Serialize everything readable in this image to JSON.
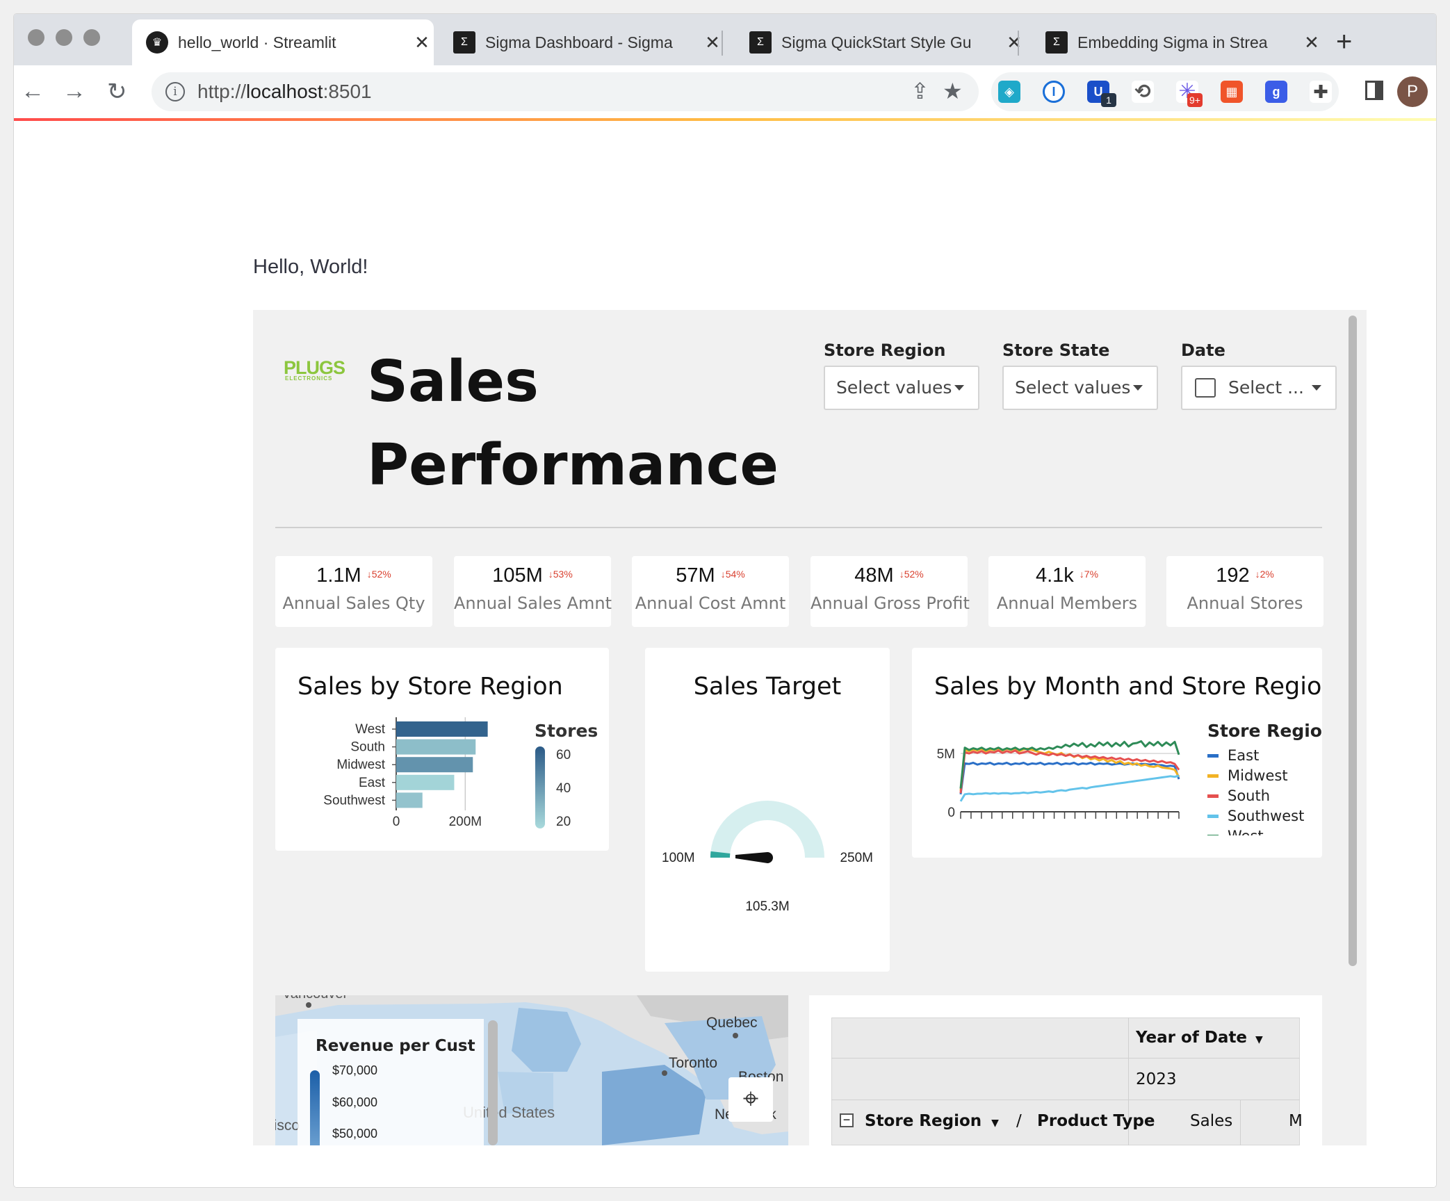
{
  "browser": {
    "tabs": [
      {
        "title": "hello_world · Streamlit",
        "favicon": "streamlit-crown-icon"
      },
      {
        "title": "Sigma Dashboard - Sigma",
        "favicon": "sigma-icon"
      },
      {
        "title": "Sigma QuickStart Style Gu",
        "favicon": "sigma-icon"
      },
      {
        "title": "Embedding Sigma in Strea",
        "favicon": "sigma-icon"
      }
    ],
    "url_prefix": "http://",
    "url_host": "localhost",
    "url_port": ":8501",
    "extension_badges": [
      "1",
      "9+"
    ],
    "profile_initial": "P"
  },
  "page": {
    "greeting": "Hello, World!"
  },
  "dashboard": {
    "logo": "PLUGS",
    "logo_sub": "ELECTRONICS",
    "title": "Sales Performance",
    "filters": [
      {
        "label": "Store Region",
        "value": "Select values"
      },
      {
        "label": "Store State",
        "value": "Select values"
      },
      {
        "label": "Date",
        "value": "Select ..."
      }
    ],
    "kpis": [
      {
        "value": "1.1M",
        "change": "52%",
        "label": "Annual Sales Qty"
      },
      {
        "value": "105M",
        "change": "53%",
        "label": "Annual Sales Amnt"
      },
      {
        "value": "57M",
        "change": "54%",
        "label": "Annual Cost Amnt"
      },
      {
        "value": "48M",
        "change": "52%",
        "label": "Annual Gross Profit"
      },
      {
        "value": "4.1k",
        "change": "7%",
        "label": "Annual Members"
      },
      {
        "value": "192",
        "change": "2%",
        "label": "Annual Stores"
      }
    ],
    "map": {
      "legend_title": "Revenue per Cust",
      "legend_ticks": [
        "$70,000",
        "$60,000",
        "$50,000"
      ],
      "places": [
        "Vancouver",
        "Quebec",
        "Toronto",
        "Boston",
        "United States",
        "New York",
        "Francisco"
      ]
    },
    "pivot": {
      "col_header": "Year of Date",
      "year": "2023",
      "row_header_1": "Store Region",
      "separator": "/",
      "row_header_2": "Product Type",
      "measure_1": "Sales",
      "measure_2": "M"
    }
  },
  "chart_data": [
    {
      "type": "bar",
      "title": "Sales by Store Region",
      "orientation": "horizontal",
      "categories": [
        "West",
        "South",
        "Midwest",
        "East",
        "Southwest"
      ],
      "values": [
        265,
        230,
        222,
        168,
        76
      ],
      "value_unit": "M",
      "xlim": [
        0,
        280
      ],
      "x_ticks": [
        "0",
        "200M"
      ],
      "legend_title": "Stores",
      "color_by": "stores",
      "color_values": [
        62,
        30,
        45,
        22,
        28
      ],
      "color_ticks": [
        "60",
        "40",
        "20"
      ],
      "color_light": "#a9dadc",
      "color_dark": "#2b5a87"
    },
    {
      "type": "gauge",
      "title": "Sales Target",
      "min": 100,
      "max": 250,
      "value": 105.3,
      "min_label": "100M",
      "max_label": "250M",
      "value_label": "105.3M",
      "track_color": "#d6efef",
      "fill_color": "#2fa79d"
    },
    {
      "type": "line",
      "title": "Sales by Month and Store Region",
      "legend_title": "Store Region",
      "y_ticks": [
        "5M",
        "0"
      ],
      "ylim": [
        0,
        6.2
      ],
      "x": [
        1,
        2,
        3,
        4,
        5,
        6,
        7,
        8,
        9,
        10,
        11,
        12,
        13,
        14,
        15,
        16,
        17,
        18,
        19,
        20,
        21,
        22,
        23,
        24,
        25,
        26,
        27,
        28,
        29,
        30,
        31,
        32,
        33,
        34,
        35,
        36,
        37,
        38,
        39,
        40,
        41,
        42,
        43,
        44,
        45,
        46,
        47,
        48,
        49,
        50,
        51,
        52,
        53
      ],
      "series": [
        {
          "name": "East",
          "color": "#2a6fc7",
          "values": [
            1.5,
            4.15,
            4.1,
            4.2,
            4.05,
            4.15,
            4.1,
            4.2,
            4.05,
            4.15,
            4.1,
            4.2,
            4.05,
            4.15,
            4.1,
            4.2,
            4.05,
            4.15,
            4.1,
            4.2,
            4.05,
            4.15,
            4.1,
            4.2,
            4.05,
            4.15,
            4.1,
            4.2,
            4.05,
            4.15,
            4.1,
            4.2,
            4.05,
            4.15,
            4.1,
            4.15,
            4.05,
            4.1,
            4.15,
            4.05,
            4.1,
            4.15,
            4.05,
            4.1,
            4.1,
            4.05,
            4.1,
            4.0,
            4.0,
            3.9,
            3.95,
            3.9,
            2.8
          ]
        },
        {
          "name": "Midwest",
          "color": "#f2b325",
          "values": [
            1.8,
            5.3,
            5.2,
            5.35,
            5.25,
            5.4,
            5.2,
            5.35,
            5.3,
            5.45,
            5.25,
            5.4,
            5.3,
            5.45,
            5.2,
            5.35,
            5.4,
            5.3,
            5.2,
            5.1,
            5.0,
            5.15,
            5.0,
            4.9,
            5.05,
            4.8,
            4.95,
            4.7,
            4.85,
            4.6,
            4.75,
            4.5,
            4.6,
            4.4,
            4.55,
            4.3,
            4.45,
            4.2,
            4.35,
            4.1,
            4.2,
            4.05,
            4.15,
            3.95,
            4.05,
            3.9,
            3.85,
            3.95,
            3.8,
            3.75,
            3.7,
            3.6,
            3.0
          ]
        },
        {
          "name": "South",
          "color": "#e5504f",
          "values": [
            1.6,
            5.1,
            5.0,
            5.15,
            5.05,
            5.2,
            5.0,
            5.15,
            5.1,
            5.25,
            5.05,
            5.2,
            5.1,
            5.25,
            5.0,
            5.1,
            5.2,
            5.05,
            4.9,
            5.05,
            4.95,
            4.85,
            5.0,
            4.85,
            4.95,
            4.8,
            4.9,
            4.75,
            4.85,
            4.7,
            4.8,
            4.65,
            4.75,
            4.6,
            4.7,
            4.55,
            4.65,
            4.5,
            4.6,
            4.45,
            4.55,
            4.4,
            4.5,
            4.35,
            4.45,
            4.3,
            4.4,
            4.25,
            4.35,
            4.2,
            4.25,
            4.1,
            3.6
          ]
        },
        {
          "name": "Southwest",
          "color": "#63c3ea",
          "values": [
            0.9,
            1.5,
            1.55,
            1.5,
            1.55,
            1.55,
            1.6,
            1.55,
            1.6,
            1.55,
            1.6,
            1.6,
            1.55,
            1.6,
            1.6,
            1.65,
            1.6,
            1.65,
            1.7,
            1.65,
            1.7,
            1.75,
            1.7,
            1.8,
            1.85,
            1.8,
            1.9,
            1.95,
            2.0,
            2.05,
            2.0,
            2.1,
            2.15,
            2.2,
            2.25,
            2.3,
            2.35,
            2.4,
            2.45,
            2.5,
            2.55,
            2.6,
            2.65,
            2.7,
            2.75,
            2.8,
            2.85,
            2.9,
            2.95,
            3.0,
            3.05,
            3.0,
            3.1
          ]
        },
        {
          "name": "West",
          "color": "#2e8b57",
          "values": [
            2.0,
            5.5,
            5.3,
            5.45,
            5.35,
            5.5,
            5.3,
            5.45,
            5.35,
            5.5,
            5.3,
            5.45,
            5.35,
            5.5,
            5.3,
            5.45,
            5.35,
            5.5,
            5.3,
            5.45,
            5.35,
            5.5,
            5.4,
            5.6,
            5.5,
            5.75,
            5.6,
            5.85,
            5.65,
            5.9,
            5.55,
            5.8,
            5.6,
            5.95,
            5.7,
            5.95,
            5.6,
            5.9,
            5.65,
            6.0,
            5.6,
            5.85,
            5.9,
            6.05,
            5.6,
            5.95,
            5.7,
            6.0,
            5.65,
            5.95,
            5.7,
            6.0,
            4.9
          ]
        }
      ]
    }
  ]
}
